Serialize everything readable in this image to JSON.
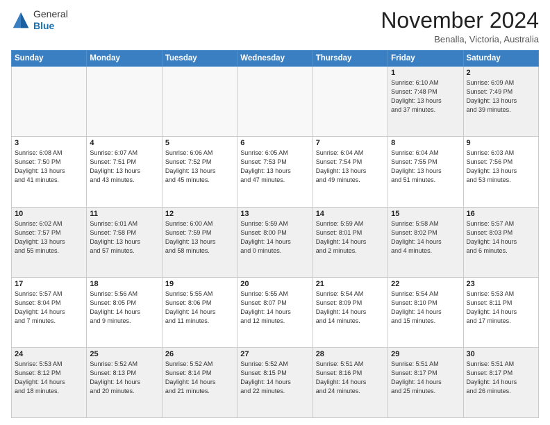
{
  "header": {
    "logo_line1": "General",
    "logo_line2": "Blue",
    "month": "November 2024",
    "location": "Benalla, Victoria, Australia"
  },
  "weekdays": [
    "Sunday",
    "Monday",
    "Tuesday",
    "Wednesday",
    "Thursday",
    "Friday",
    "Saturday"
  ],
  "weeks": [
    [
      {
        "day": "",
        "info": "",
        "empty": true
      },
      {
        "day": "",
        "info": "",
        "empty": true
      },
      {
        "day": "",
        "info": "",
        "empty": true
      },
      {
        "day": "",
        "info": "",
        "empty": true
      },
      {
        "day": "",
        "info": "",
        "empty": true
      },
      {
        "day": "1",
        "info": "Sunrise: 6:10 AM\nSunset: 7:48 PM\nDaylight: 13 hours\nand 37 minutes."
      },
      {
        "day": "2",
        "info": "Sunrise: 6:09 AM\nSunset: 7:49 PM\nDaylight: 13 hours\nand 39 minutes."
      }
    ],
    [
      {
        "day": "3",
        "info": "Sunrise: 6:08 AM\nSunset: 7:50 PM\nDaylight: 13 hours\nand 41 minutes."
      },
      {
        "day": "4",
        "info": "Sunrise: 6:07 AM\nSunset: 7:51 PM\nDaylight: 13 hours\nand 43 minutes."
      },
      {
        "day": "5",
        "info": "Sunrise: 6:06 AM\nSunset: 7:52 PM\nDaylight: 13 hours\nand 45 minutes."
      },
      {
        "day": "6",
        "info": "Sunrise: 6:05 AM\nSunset: 7:53 PM\nDaylight: 13 hours\nand 47 minutes."
      },
      {
        "day": "7",
        "info": "Sunrise: 6:04 AM\nSunset: 7:54 PM\nDaylight: 13 hours\nand 49 minutes."
      },
      {
        "day": "8",
        "info": "Sunrise: 6:04 AM\nSunset: 7:55 PM\nDaylight: 13 hours\nand 51 minutes."
      },
      {
        "day": "9",
        "info": "Sunrise: 6:03 AM\nSunset: 7:56 PM\nDaylight: 13 hours\nand 53 minutes."
      }
    ],
    [
      {
        "day": "10",
        "info": "Sunrise: 6:02 AM\nSunset: 7:57 PM\nDaylight: 13 hours\nand 55 minutes."
      },
      {
        "day": "11",
        "info": "Sunrise: 6:01 AM\nSunset: 7:58 PM\nDaylight: 13 hours\nand 57 minutes."
      },
      {
        "day": "12",
        "info": "Sunrise: 6:00 AM\nSunset: 7:59 PM\nDaylight: 13 hours\nand 58 minutes."
      },
      {
        "day": "13",
        "info": "Sunrise: 5:59 AM\nSunset: 8:00 PM\nDaylight: 14 hours\nand 0 minutes."
      },
      {
        "day": "14",
        "info": "Sunrise: 5:59 AM\nSunset: 8:01 PM\nDaylight: 14 hours\nand 2 minutes."
      },
      {
        "day": "15",
        "info": "Sunrise: 5:58 AM\nSunset: 8:02 PM\nDaylight: 14 hours\nand 4 minutes."
      },
      {
        "day": "16",
        "info": "Sunrise: 5:57 AM\nSunset: 8:03 PM\nDaylight: 14 hours\nand 6 minutes."
      }
    ],
    [
      {
        "day": "17",
        "info": "Sunrise: 5:57 AM\nSunset: 8:04 PM\nDaylight: 14 hours\nand 7 minutes."
      },
      {
        "day": "18",
        "info": "Sunrise: 5:56 AM\nSunset: 8:05 PM\nDaylight: 14 hours\nand 9 minutes."
      },
      {
        "day": "19",
        "info": "Sunrise: 5:55 AM\nSunset: 8:06 PM\nDaylight: 14 hours\nand 11 minutes."
      },
      {
        "day": "20",
        "info": "Sunrise: 5:55 AM\nSunset: 8:07 PM\nDaylight: 14 hours\nand 12 minutes."
      },
      {
        "day": "21",
        "info": "Sunrise: 5:54 AM\nSunset: 8:09 PM\nDaylight: 14 hours\nand 14 minutes."
      },
      {
        "day": "22",
        "info": "Sunrise: 5:54 AM\nSunset: 8:10 PM\nDaylight: 14 hours\nand 15 minutes."
      },
      {
        "day": "23",
        "info": "Sunrise: 5:53 AM\nSunset: 8:11 PM\nDaylight: 14 hours\nand 17 minutes."
      }
    ],
    [
      {
        "day": "24",
        "info": "Sunrise: 5:53 AM\nSunset: 8:12 PM\nDaylight: 14 hours\nand 18 minutes."
      },
      {
        "day": "25",
        "info": "Sunrise: 5:52 AM\nSunset: 8:13 PM\nDaylight: 14 hours\nand 20 minutes."
      },
      {
        "day": "26",
        "info": "Sunrise: 5:52 AM\nSunset: 8:14 PM\nDaylight: 14 hours\nand 21 minutes."
      },
      {
        "day": "27",
        "info": "Sunrise: 5:52 AM\nSunset: 8:15 PM\nDaylight: 14 hours\nand 22 minutes."
      },
      {
        "day": "28",
        "info": "Sunrise: 5:51 AM\nSunset: 8:16 PM\nDaylight: 14 hours\nand 24 minutes."
      },
      {
        "day": "29",
        "info": "Sunrise: 5:51 AM\nSunset: 8:17 PM\nDaylight: 14 hours\nand 25 minutes."
      },
      {
        "day": "30",
        "info": "Sunrise: 5:51 AM\nSunset: 8:17 PM\nDaylight: 14 hours\nand 26 minutes."
      }
    ]
  ]
}
